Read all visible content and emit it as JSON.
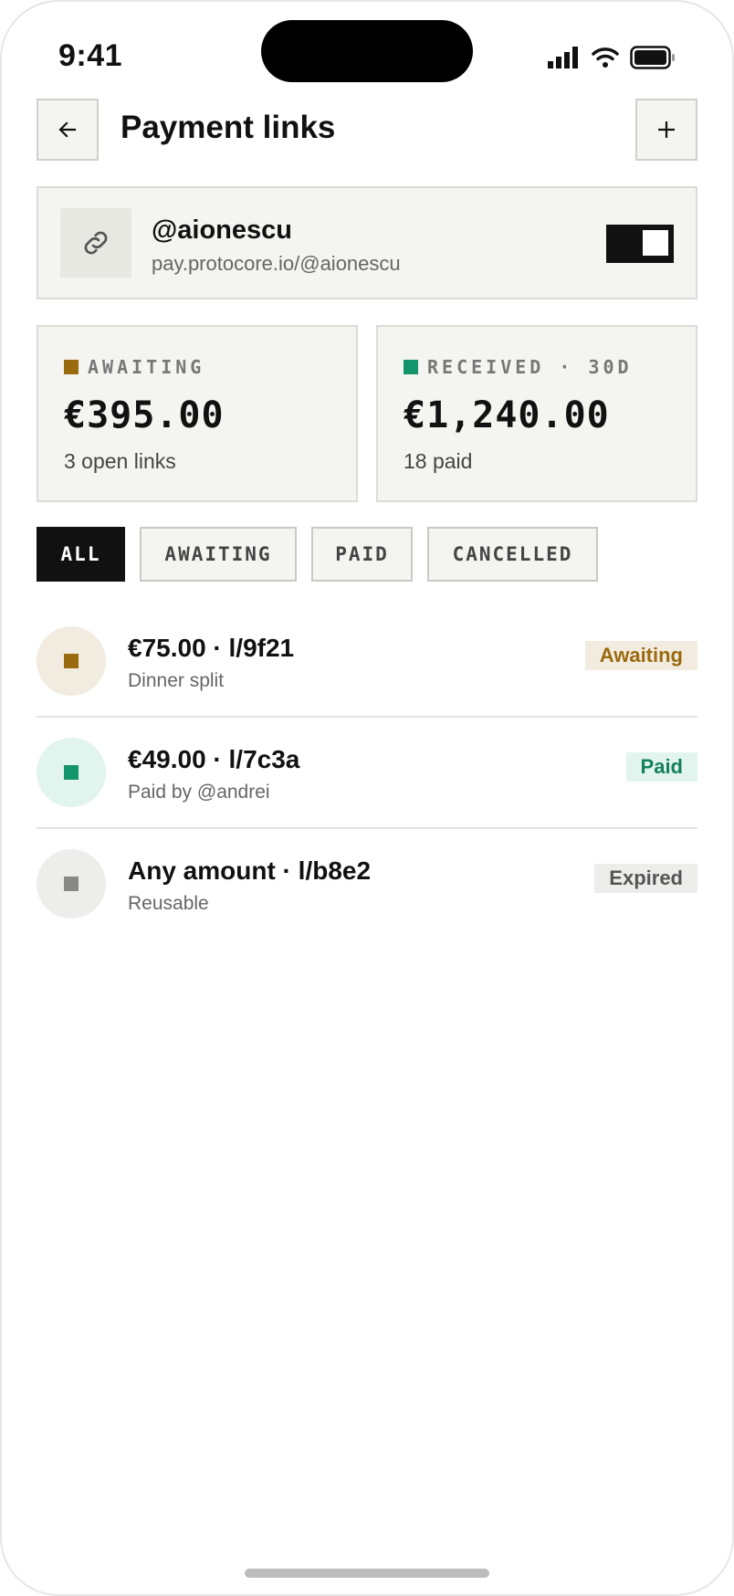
{
  "status_bar": {
    "time": "9:41",
    "icons": [
      "cellular-signal-icon",
      "wifi-icon",
      "battery-icon"
    ]
  },
  "header": {
    "title": "Payment links",
    "back_icon": "arrow-left-icon",
    "add_icon": "plus-icon"
  },
  "handle_card": {
    "icon": "link-icon",
    "handle": "@aionescu",
    "url": "pay.protocore.io/@aionescu",
    "toggle_on": true
  },
  "stats": {
    "awaiting": {
      "label": "AWAITING",
      "value": "€395.00",
      "sub": "3 open links",
      "color": "#9a6a0e"
    },
    "received": {
      "label": "RECEIVED · 30D",
      "value": "€1,240.00",
      "sub": "18 paid",
      "color": "#14946a"
    }
  },
  "filters": {
    "active": "ALL",
    "items": [
      "ALL",
      "AWAITING",
      "PAID",
      "CANCELLED"
    ]
  },
  "links": [
    {
      "title": "€75.00 · l/9f21",
      "subtitle": "Dinner split",
      "status": "Awaiting",
      "status_color": "#9a6a0e",
      "status_bg": "#f2ece0",
      "avatar_bg": "#f2ece0"
    },
    {
      "title": "€49.00 · l/7c3a",
      "subtitle": "Paid by @andrei",
      "status": "Paid",
      "status_color": "#14805c",
      "status_bg": "#e2f4ee",
      "avatar_bg": "#e2f4ee"
    },
    {
      "title": "Any amount · l/b8e2",
      "subtitle": "Reusable",
      "status": "Expired",
      "status_color": "#555555",
      "status_bg": "#ededeb",
      "avatar_bg": "#ededeb"
    }
  ]
}
